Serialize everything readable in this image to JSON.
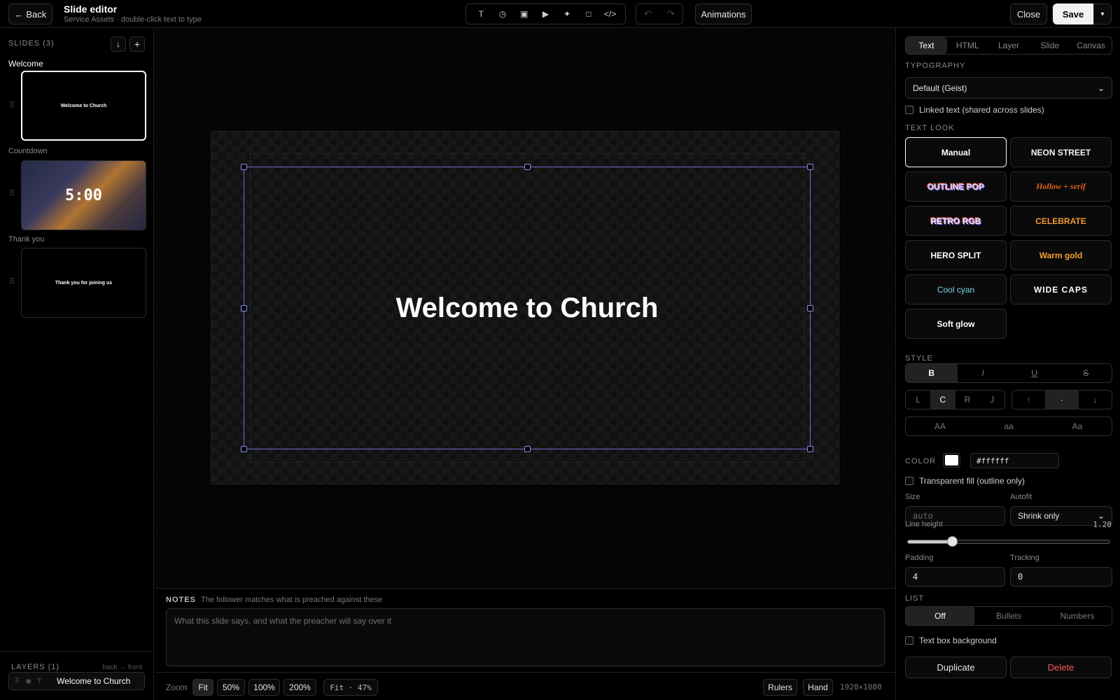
{
  "topbar": {
    "back_label": "← Back",
    "title": "Slide editor",
    "subtitle": "Service Assets · double-click text to type",
    "tools": [
      {
        "icon": "text-tool-icon",
        "glyph": "T"
      },
      {
        "icon": "timer-tool-icon",
        "glyph": "◷"
      },
      {
        "icon": "image-tool-icon",
        "glyph": "▣"
      },
      {
        "icon": "video-tool-icon",
        "glyph": "▶"
      },
      {
        "icon": "sparkle-tool-icon",
        "glyph": "✦"
      },
      {
        "icon": "shape-tool-icon",
        "glyph": "□"
      },
      {
        "icon": "html-tool-icon",
        "glyph": "</>"
      }
    ],
    "undo_glyph": "↶",
    "redo_glyph": "↷",
    "animations_label": "Animations",
    "close_label": "Close",
    "save_label": "Save",
    "save_more_glyph": "▾"
  },
  "slides": {
    "heading": "SLIDES (3)",
    "down_glyph": "↓",
    "add_glyph": "+",
    "items": [
      {
        "label": "Welcome",
        "thumb_text": "Welcome to Church"
      },
      {
        "label": "Countdown",
        "thumb_text": "5:00"
      },
      {
        "label": "Thank you",
        "thumb_text": "Thank you for joining us"
      }
    ]
  },
  "layers": {
    "heading": "LAYERS (1)",
    "hint": "back → front",
    "items": [
      {
        "name": "Welcome to Church",
        "type_glyph": "T"
      }
    ]
  },
  "canvas": {
    "text": "Welcome to Church",
    "selection_color": "#6b6fd8"
  },
  "notes": {
    "label": "NOTES",
    "hint": "The follower matches what is preached against these",
    "placeholder": "What this slide says, and what the preacher will say over it"
  },
  "bottombar": {
    "zoom_label": "Zoom",
    "zoom_options": [
      "Fit",
      "50%",
      "100%",
      "200%"
    ],
    "zoom_selected": "Fit",
    "zoom_readout": "Fit · 47%",
    "rulers_label": "Rulers",
    "hand_label": "Hand",
    "dimensions": "1920×1080"
  },
  "inspector": {
    "tabs": [
      "Text",
      "HTML",
      "Layer",
      "Slide",
      "Canvas"
    ],
    "active_tab": "Text",
    "typography_heading": "TYPOGRAPHY",
    "font_value": "Default (Geist)",
    "linked_text_label": "Linked text (shared across slides)",
    "text_look_heading": "TEXT LOOK",
    "looks": [
      {
        "label": "Manual",
        "color": "#ffffff"
      },
      {
        "label": "NEON STREET",
        "color": "#f4f4f4"
      },
      {
        "label": "OUTLINE POP",
        "color": "#d9d9d9"
      },
      {
        "label": "Hollow + serif",
        "color": "#e0621a"
      },
      {
        "label": "RETRO RGB",
        "color": "#e6e6e6"
      },
      {
        "label": "CELEBRATE",
        "color": "#f39a33"
      },
      {
        "label": "HERO SPLIT",
        "color": "#ffffff"
      },
      {
        "label": "Warm gold",
        "color": "#f0a030"
      },
      {
        "label": "Cool cyan",
        "color": "#7fd6f2"
      },
      {
        "label": "WIDE CAPS",
        "color": "#ffffff"
      },
      {
        "label": "Soft glow",
        "color": "#ffffff"
      }
    ],
    "style_heading": "STYLE",
    "style_buttons": [
      "B",
      "I",
      "U",
      "S"
    ],
    "align_buttons": [
      "L",
      "C",
      "R",
      "J"
    ],
    "align_selected": "C",
    "valign_buttons": [
      "↑",
      "·",
      "↓"
    ],
    "valign_selected": "·",
    "case_buttons": [
      "AA",
      "aa",
      "Aa"
    ],
    "color_heading": "COLOR",
    "color_value": "#ffffff",
    "transparent_fill_label": "Transparent fill (outline only)",
    "size_label": "Size",
    "size_placeholder": "auto",
    "autofit_label": "Autofit",
    "autofit_value": "Shrink only",
    "line_height_label": "Line height",
    "line_height_value": "1.20",
    "line_height_fraction": 0.22,
    "padding_label": "Padding",
    "padding_value": "4",
    "tracking_label": "Tracking",
    "tracking_value": "0",
    "list_heading": "LIST",
    "list_options": [
      "Off",
      "Bullets",
      "Numbers"
    ],
    "list_selected": "Off",
    "textbox_bg_label": "Text box background",
    "duplicate_label": "Duplicate",
    "delete_label": "Delete"
  }
}
